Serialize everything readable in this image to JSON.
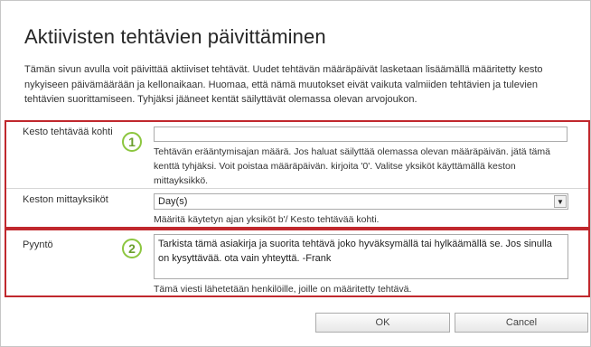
{
  "title": "Aktiivisten tehtävien päivittäminen",
  "description": "Tämän sivun avulla voit päivittää aktiiviset tehtävät. Uudet tehtävän määräpäivät lasketaan lisäämällä määritetty kesto nykyiseen päivämäärään ja kellonaikaan. Huomaa, että nämä muutokset eivät vaikuta valmiiden tehtävien ja tulevien tehtävien suorittamiseen. Tyhjäksi jääneet kentät säilyttävät olemassa olevan arvojoukon.",
  "section1": {
    "badge": "1",
    "duration": {
      "label": "Kesto tehtävää kohti",
      "value": "",
      "help": "Tehtävän erääntymisajan määrä. Jos haluat säilyttää olemassa olevan määräpäivän. jätä tämä kenttä tyhjäksi. Voit poistaa määräpäivän. kirjoita '0'. Valitse yksiköt käyttämällä keston mittayksikkö."
    },
    "units": {
      "label": "Keston mittayksiköt",
      "selected": "Day(s)",
      "help": "Määritä käytetyn ajan yksiköt b'/ Kesto tehtävää kohti."
    }
  },
  "section2": {
    "badge": "2",
    "request": {
      "label": "Pyyntö",
      "value": "Tarkista tämä asiakirja ja suorita tehtävä joko hyväksymällä tai hylkäämällä se. Jos sinulla on kysyttävää. ota vain yhteyttä. -Frank",
      "help": "Tämä viesti lähetetään henkilöille, joille on määritetty tehtävä."
    }
  },
  "buttons": {
    "ok": "OK",
    "cancel": "Cancel"
  },
  "icons": {
    "select_arrow": "dropdown-arrow-icon"
  },
  "colors": {
    "highlight_border": "#c0282d",
    "badge": "#8cc63f"
  }
}
